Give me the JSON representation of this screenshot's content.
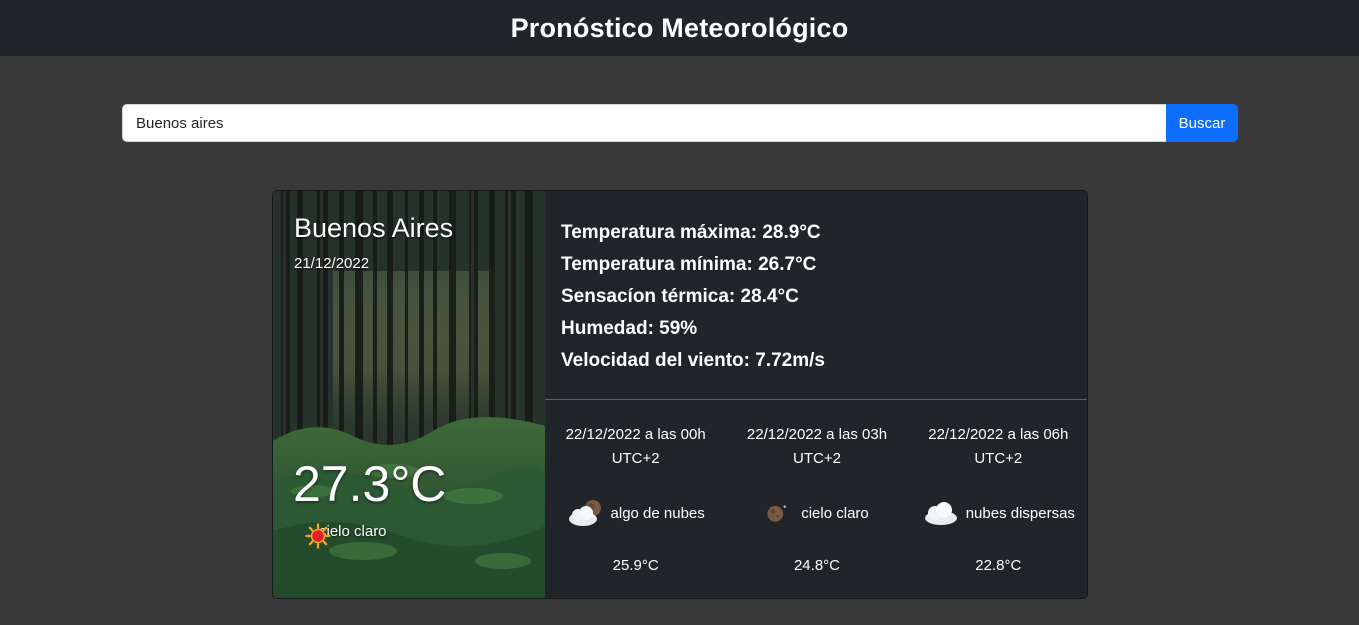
{
  "header": {
    "title": "Pronóstico Meteorológico"
  },
  "search": {
    "value": "Buenos aires",
    "button_label": "Buscar"
  },
  "current": {
    "city": "Buenos Aires",
    "date": "21/12/2022",
    "temperature": "27.3°C",
    "condition": "cielo claro",
    "condition_icon": "sun-icon"
  },
  "details": {
    "max": "Temperatura máxima: 28.9°C",
    "min": "Temperatura mínima: 26.7°C",
    "feels": "Sensacíon térmica: 28.4°C",
    "humidity": "Humedad: 59%",
    "wind": "Velocidad del viento: 7.72m/s"
  },
  "forecast": [
    {
      "datetime": "22/12/2022 a las 00h",
      "tz": "UTC+2",
      "condition": "algo de nubes",
      "icon": "few-clouds-night-icon",
      "temp": "25.9°C"
    },
    {
      "datetime": "22/12/2022 a las 03h",
      "tz": "UTC+2",
      "condition": "cielo claro",
      "icon": "moon-icon",
      "temp": "24.8°C"
    },
    {
      "datetime": "22/12/2022 a las 06h",
      "tz": "UTC+2",
      "condition": "nubes dispersas",
      "icon": "cloud-icon",
      "temp": "22.8°C"
    }
  ]
}
